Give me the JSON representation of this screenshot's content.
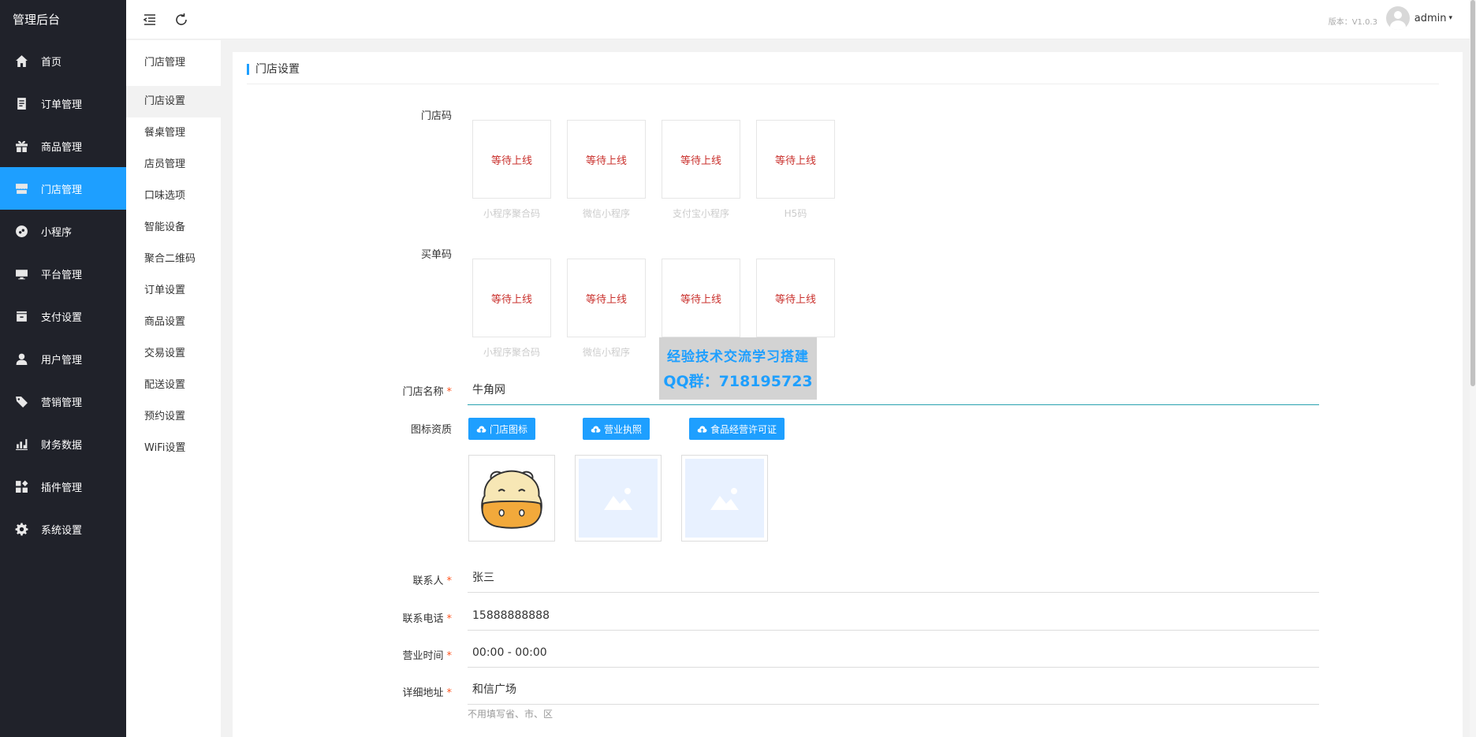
{
  "app": {
    "title": "管理后台"
  },
  "sidebar": {
    "items": [
      {
        "label": "首页",
        "icon": "home-icon",
        "active": false
      },
      {
        "label": "订单管理",
        "icon": "order-list-icon",
        "active": false
      },
      {
        "label": "商品管理",
        "icon": "gift-icon",
        "active": false
      },
      {
        "label": "门店管理",
        "icon": "store-icon",
        "active": true
      },
      {
        "label": "小程序",
        "icon": "mini-program-icon",
        "active": false
      },
      {
        "label": "平台管理",
        "icon": "monitor-icon",
        "active": false
      },
      {
        "label": "支付设置",
        "icon": "wallet-icon",
        "active": false
      },
      {
        "label": "用户管理",
        "icon": "user-icon",
        "active": false
      },
      {
        "label": "营销管理",
        "icon": "tag-icon",
        "active": false
      },
      {
        "label": "财务数据",
        "icon": "bar-chart-icon",
        "active": false
      },
      {
        "label": "插件管理",
        "icon": "apps-icon",
        "active": false
      },
      {
        "label": "系统设置",
        "icon": "gear-icon",
        "active": false
      }
    ]
  },
  "header": {
    "version": "版本：V1.0.3",
    "username": "admin",
    "caret": "▾"
  },
  "subnav": {
    "title": "门店管理",
    "items": [
      {
        "label": "门店设置",
        "active": true
      },
      {
        "label": "餐桌管理"
      },
      {
        "label": "店员管理"
      },
      {
        "label": "口味选项"
      },
      {
        "label": "智能设备"
      },
      {
        "label": "聚合二维码"
      },
      {
        "label": "订单设置"
      },
      {
        "label": "商品设置"
      },
      {
        "label": "交易设置"
      },
      {
        "label": "配送设置"
      },
      {
        "label": "预约设置"
      },
      {
        "label": "WiFi设置"
      }
    ]
  },
  "main": {
    "title": "门店设置",
    "store_code": {
      "label": "门店码",
      "boxes": [
        {
          "text": "等待上线",
          "caption": "小程序聚合码"
        },
        {
          "text": "等待上线",
          "caption": "微信小程序"
        },
        {
          "text": "等待上线",
          "caption": "支付宝小程序"
        },
        {
          "text": "等待上线",
          "caption": "H5码"
        }
      ]
    },
    "pay_code": {
      "label": "买单码",
      "boxes": [
        {
          "text": "等待上线",
          "caption": "小程序聚合码"
        },
        {
          "text": "等待上线",
          "caption": "微信小程序"
        },
        {
          "text": "等待上线"
        },
        {
          "text": "等待上线"
        }
      ]
    },
    "store_name": {
      "label": "门店名称",
      "required": "*",
      "value": "牛角网"
    },
    "icons": {
      "label": "图标资质",
      "buttons": [
        {
          "label": "门店图标",
          "icon": "cloud-upload-icon"
        },
        {
          "label": "营业执照",
          "icon": "cloud-upload-icon"
        },
        {
          "label": "食品经营许可证",
          "icon": "cloud-upload-icon"
        }
      ],
      "thumbs": [
        {
          "kind": "mascot",
          "icon": "hippo-logo-icon"
        },
        {
          "kind": "placeholder",
          "icon": "image-placeholder-icon"
        },
        {
          "kind": "placeholder",
          "icon": "image-placeholder-icon"
        }
      ]
    },
    "contact": {
      "label": "联系人",
      "required": "*",
      "value": "张三"
    },
    "phone": {
      "label": "联系电话",
      "required": "*",
      "value": "15888888888"
    },
    "hours": {
      "label": "营业时间",
      "required": "*",
      "value": "00:00 - 00:00"
    },
    "address": {
      "label": "详细地址",
      "required": "*",
      "value": "和信广场",
      "hint": "不用填写省、市、区"
    }
  },
  "watermark": {
    "line1": "经验技术交流学习搭建",
    "line2": "QQ群：718195723"
  },
  "colors": {
    "sidebar_bg": "#20222a",
    "accent": "#1e9fff",
    "pending_text": "#c9302c",
    "required": "#ff5722"
  }
}
